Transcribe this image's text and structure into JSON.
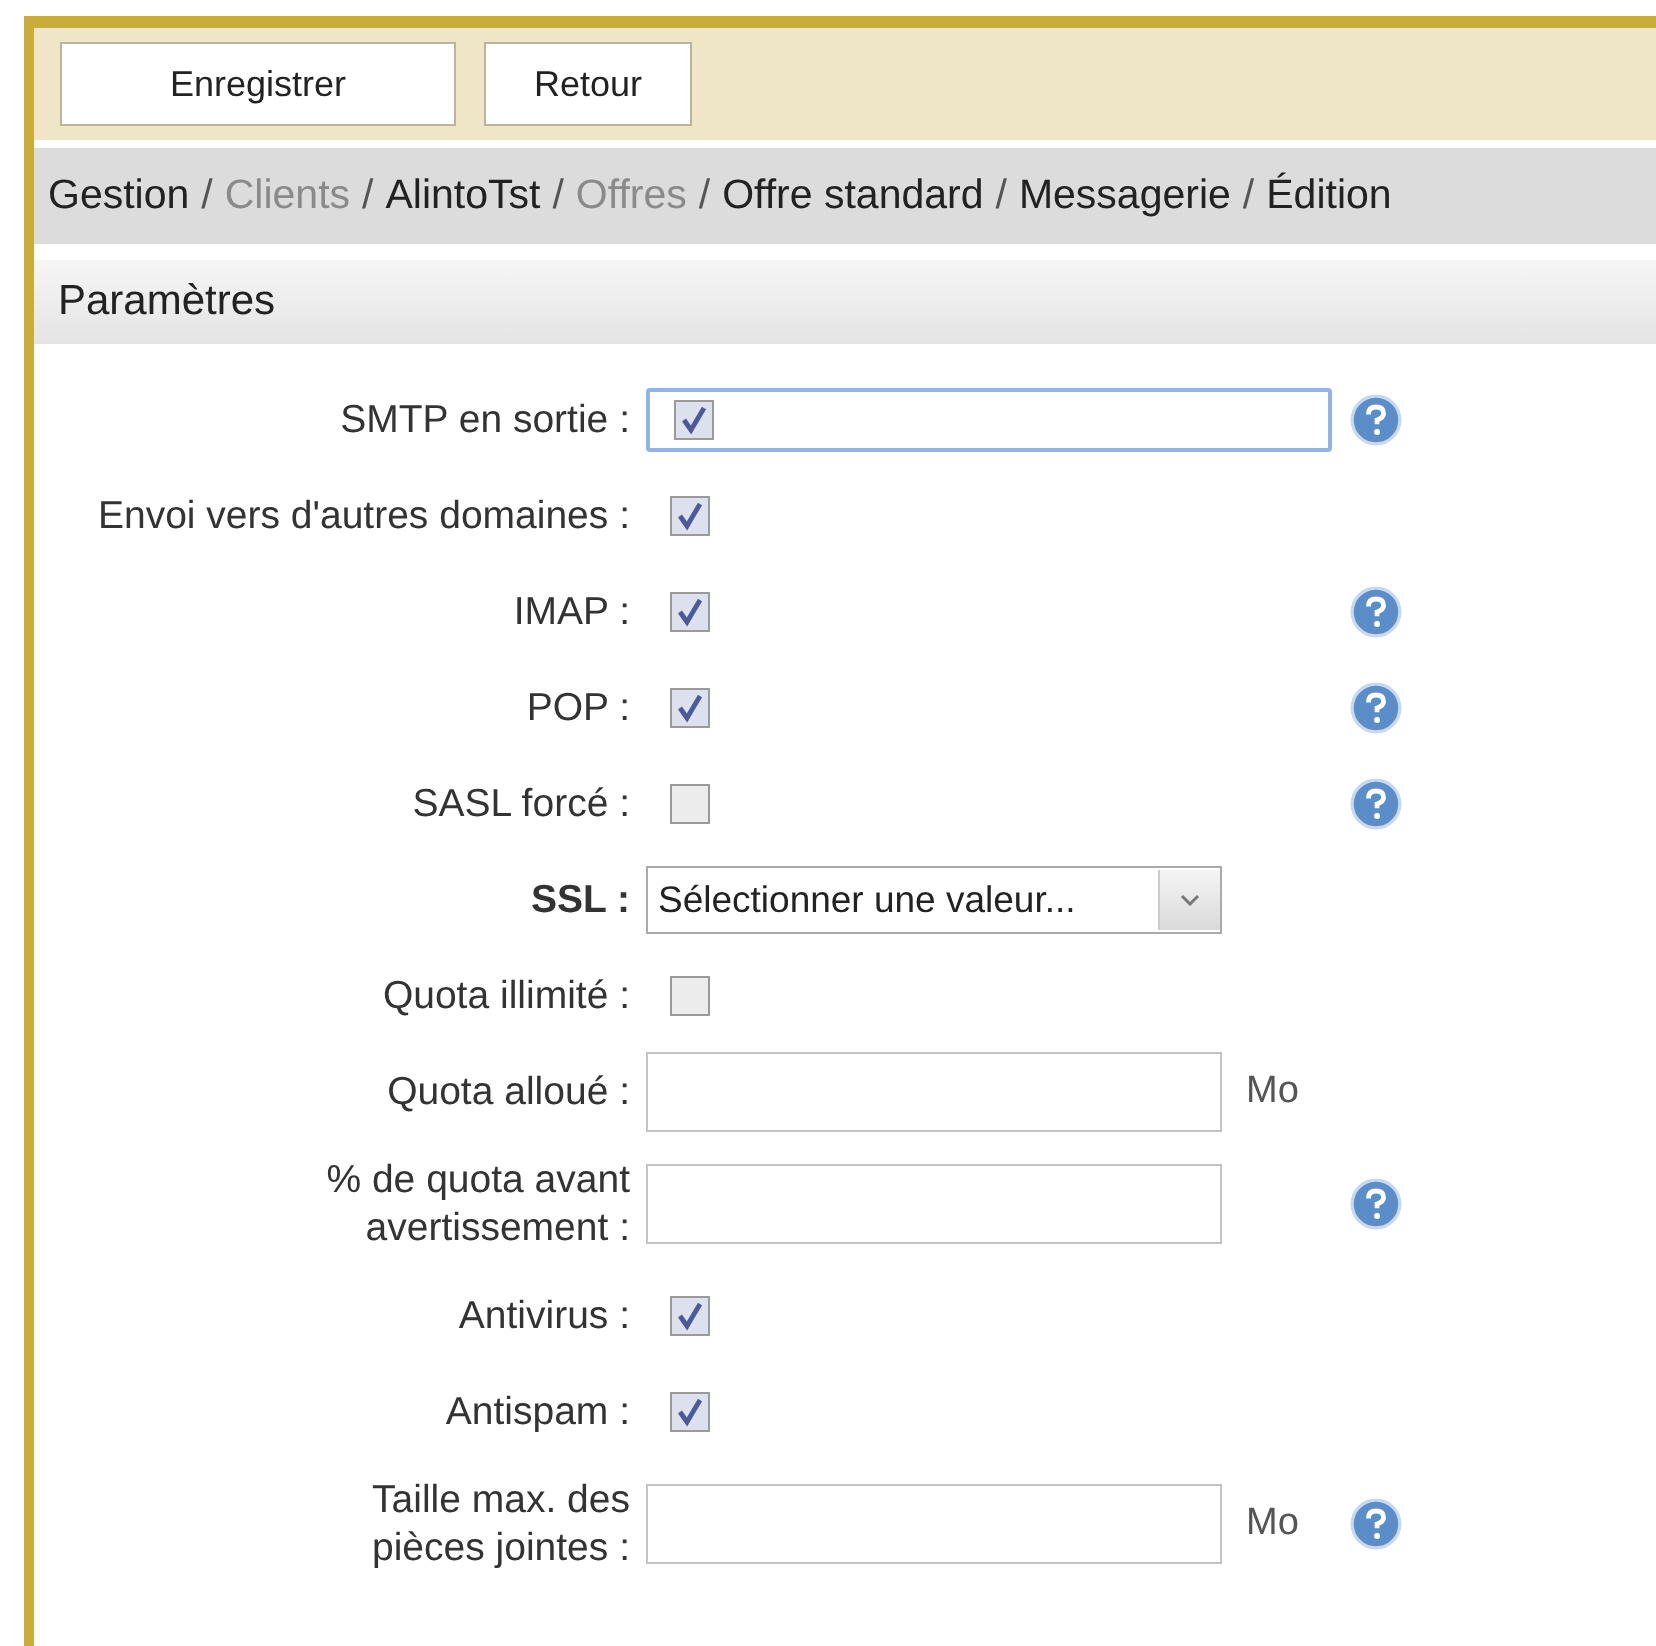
{
  "toolbar": {
    "buttons": [
      "Enregistrer",
      "Retour"
    ]
  },
  "breadcrumb": [
    {
      "label": "Gestion",
      "muted": false
    },
    {
      "label": "Clients",
      "muted": true
    },
    {
      "label": "AlintoTst",
      "muted": false
    },
    {
      "label": "Offres",
      "muted": true
    },
    {
      "label": "Offre standard",
      "muted": false
    },
    {
      "label": "Messagerie",
      "muted": false
    },
    {
      "label": "Édition",
      "muted": false
    }
  ],
  "separator": "/",
  "section": {
    "title": "Paramètres"
  },
  "fields": [
    {
      "label": "SMTP en sortie :",
      "kind": "framed-checkbox",
      "checked": true,
      "help": true
    },
    {
      "label": "Envoi vers d'autres domaines :",
      "kind": "checkbox",
      "checked": true,
      "help": false
    },
    {
      "label": "IMAP :",
      "kind": "checkbox",
      "checked": true,
      "help": true
    },
    {
      "label": "POP :",
      "kind": "checkbox",
      "checked": true,
      "help": true
    },
    {
      "label": "SASL forcé :",
      "kind": "checkbox",
      "checked": false,
      "help": true
    },
    {
      "label": "SSL :",
      "kind": "select",
      "bold": true,
      "value": "Sélectionner une valeur...",
      "help": false
    },
    {
      "label": "Quota illimité :",
      "kind": "checkbox",
      "checked": false,
      "help": false
    },
    {
      "label": "Quota alloué :",
      "kind": "text",
      "unit": "Mo",
      "help": false
    },
    {
      "label": "% de quota avant avertissement :",
      "kind": "text",
      "help": true
    },
    {
      "label": "Antivirus :",
      "kind": "checkbox",
      "checked": true,
      "help": false
    },
    {
      "label": "Antispam :",
      "kind": "checkbox",
      "checked": true,
      "help": false
    },
    {
      "label": "Taille max. des pièces jointes :",
      "kind": "text",
      "unit": "Mo",
      "help": true
    }
  ]
}
